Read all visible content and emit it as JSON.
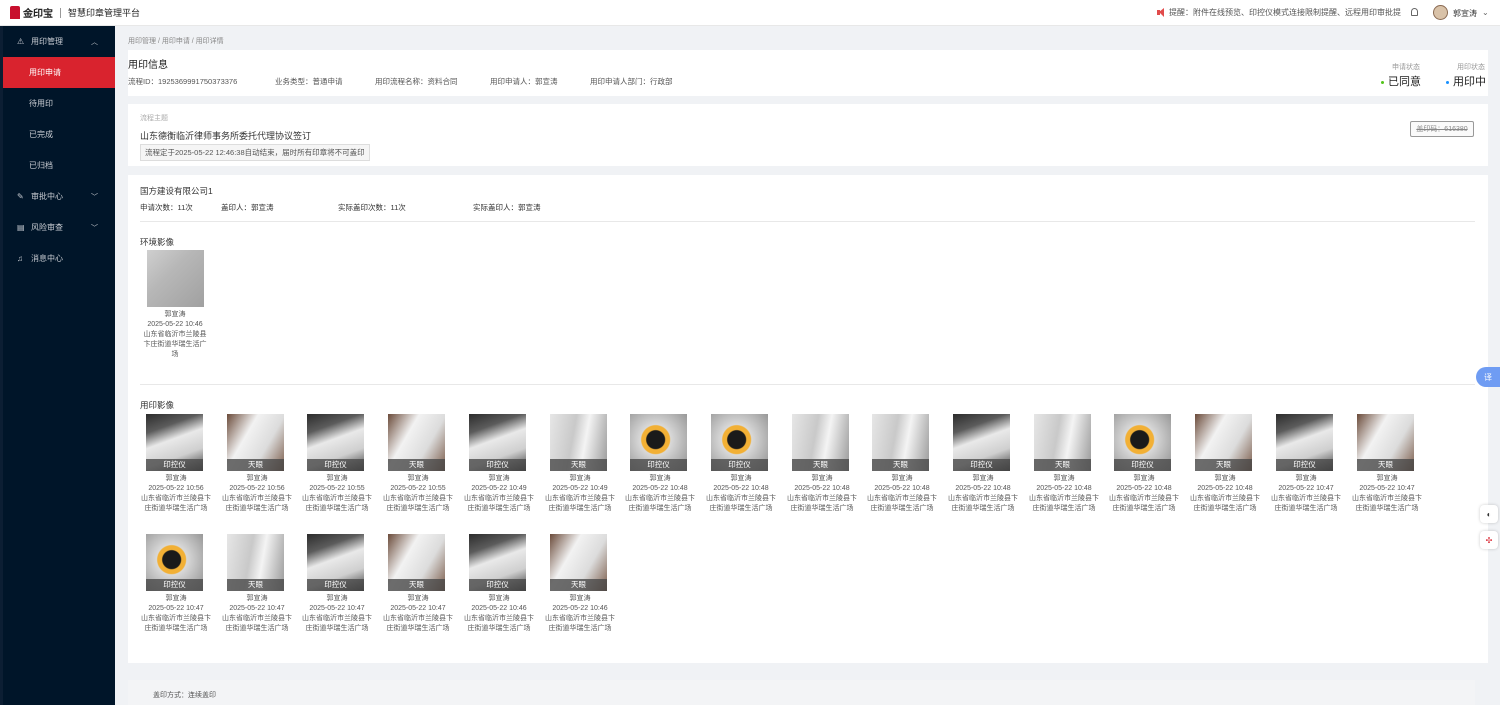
{
  "topbar": {
    "logo_text": "金印宝",
    "system_title": "智慧印章管理平台",
    "notice": "提醒：附件在线预览、印控仪模式连接限制提醒、远程用印审批提",
    "username": "郭宣涛"
  },
  "sidebar": {
    "items": [
      {
        "label": "用印管理",
        "icon": "⚠",
        "arrow": "︿",
        "type": "group"
      },
      {
        "label": "用印申请",
        "type": "sub",
        "active": true
      },
      {
        "label": "待用印",
        "type": "sub"
      },
      {
        "label": "已完成",
        "type": "sub"
      },
      {
        "label": "已归档",
        "type": "sub"
      },
      {
        "label": "审批中心",
        "icon": "✎",
        "arrow": "﹀",
        "type": "group"
      },
      {
        "label": "风险审查",
        "icon": "▤",
        "arrow": "﹀",
        "type": "group"
      },
      {
        "label": "消息中心",
        "icon": "♫",
        "type": "group"
      }
    ]
  },
  "breadcrumb": "用印管理 / 用印申请 / 用印详情",
  "header": {
    "title": "用印信息",
    "process_id": "流程ID：1925369991750373376",
    "business_type": "业务类型：普通申请",
    "process_name": "用印流程名称：资料合同",
    "applicant": "用印申请人：郭宣涛",
    "department": "用印申请人部门：行政部",
    "apply_status_label": "申请状态",
    "apply_status_value": "已同意",
    "apply_status_color": "#52c41a",
    "seal_status_label": "用印状态",
    "seal_status_value": "用印中",
    "seal_status_color": "#1890ff"
  },
  "flow": {
    "label": "流程主题",
    "title": "山东德衡临沂律师事务所委托代理协议签订",
    "tag": "流程定于2025-05-22 12:46:38自动结束，届时所有印章将不可盖印",
    "seal_no": "盖印码：616380"
  },
  "company": {
    "name": "国方建设有限公司1",
    "apply_count": "申请次数：11次",
    "sealer": "盖印人：郭宣涛",
    "actual_count": "实际盖印次数：11次",
    "actual_sealer": "实际盖印人：郭宣涛"
  },
  "env": {
    "label": "环境影像",
    "person": "郭宣涛",
    "time": "2025-05-22 10:46",
    "location": "山东省临沂市兰陵县卞庄街道华瑞生活广场"
  },
  "seal_images": {
    "label": "用印影像",
    "items": [
      {
        "badge": "印控仪",
        "person": "郭宣涛",
        "time": "2025-05-22 10:56",
        "location": "山东省临沂市兰陵县卞庄街道华瑞生活广场",
        "style": "a"
      },
      {
        "badge": "天眼",
        "person": "郭宣涛",
        "time": "2025-05-22 10:56",
        "location": "山东省临沂市兰陵县卞庄街道华瑞生活广场",
        "style": "b"
      },
      {
        "badge": "印控仪",
        "person": "郭宣涛",
        "time": "2025-05-22 10:55",
        "location": "山东省临沂市兰陵县卞庄街道华瑞生活广场",
        "style": "a"
      },
      {
        "badge": "天眼",
        "person": "郭宣涛",
        "time": "2025-05-22 10:55",
        "location": "山东省临沂市兰陵县卞庄街道华瑞生活广场",
        "style": "b"
      },
      {
        "badge": "印控仪",
        "person": "郭宣涛",
        "time": "2025-05-22 10:49",
        "location": "山东省临沂市兰陵县卞庄街道华瑞生活广场",
        "style": "a"
      },
      {
        "badge": "天眼",
        "person": "郭宣涛",
        "time": "2025-05-22 10:49",
        "location": "山东省临沂市兰陵县卞庄街道华瑞生活广场",
        "style": "c"
      },
      {
        "badge": "印控仪",
        "person": "郭宣涛",
        "time": "2025-05-22 10:48",
        "location": "山东省临沂市兰陵县卞庄街道华瑞生活广场",
        "style": "d"
      },
      {
        "badge": "印控仪",
        "person": "郭宣涛",
        "time": "2025-05-22 10:48",
        "location": "山东省临沂市兰陵县卞庄街道华瑞生活广场",
        "style": "d"
      },
      {
        "badge": "天眼",
        "person": "郭宣涛",
        "time": "2025-05-22 10:48",
        "location": "山东省临沂市兰陵县卞庄街道华瑞生活广场",
        "style": "c"
      },
      {
        "badge": "天眼",
        "person": "郭宣涛",
        "time": "2025-05-22 10:48",
        "location": "山东省临沂市兰陵县卞庄街道华瑞生活广场",
        "style": "c"
      },
      {
        "badge": "印控仪",
        "person": "郭宣涛",
        "time": "2025-05-22 10:48",
        "location": "山东省临沂市兰陵县卞庄街道华瑞生活广场",
        "style": "a"
      },
      {
        "badge": "天眼",
        "person": "郭宣涛",
        "time": "2025-05-22 10:48",
        "location": "山东省临沂市兰陵县卞庄街道华瑞生活广场",
        "style": "c"
      },
      {
        "badge": "印控仪",
        "person": "郭宣涛",
        "time": "2025-05-22 10:48",
        "location": "山东省临沂市兰陵县卞庄街道华瑞生活广场",
        "style": "d"
      },
      {
        "badge": "天眼",
        "person": "郭宣涛",
        "time": "2025-05-22 10:48",
        "location": "山东省临沂市兰陵县卞庄街道华瑞生活广场",
        "style": "b"
      },
      {
        "badge": "印控仪",
        "person": "郭宣涛",
        "time": "2025-05-22 10:47",
        "location": "山东省临沂市兰陵县卞庄街道华瑞生活广场",
        "style": "a"
      },
      {
        "badge": "天眼",
        "person": "郭宣涛",
        "time": "2025-05-22 10:47",
        "location": "山东省临沂市兰陵县卞庄街道华瑞生活广场",
        "style": "b"
      },
      {
        "badge": "印控仪",
        "person": "郭宣涛",
        "time": "2025-05-22 10:47",
        "location": "山东省临沂市兰陵县卞庄街道华瑞生活广场",
        "style": "d"
      },
      {
        "badge": "天眼",
        "person": "郭宣涛",
        "time": "2025-05-22 10:47",
        "location": "山东省临沂市兰陵县卞庄街道华瑞生活广场",
        "style": "c"
      },
      {
        "badge": "印控仪",
        "person": "郭宣涛",
        "time": "2025-05-22 10:47",
        "location": "山东省临沂市兰陵县卞庄街道华瑞生活广场",
        "style": "a"
      },
      {
        "badge": "天眼",
        "person": "郭宣涛",
        "time": "2025-05-22 10:47",
        "location": "山东省临沂市兰陵县卞庄街道华瑞生活广场",
        "style": "b"
      },
      {
        "badge": "印控仪",
        "person": "郭宣涛",
        "time": "2025-05-22 10:46",
        "location": "山东省临沂市兰陵县卞庄街道华瑞生活广场",
        "style": "a"
      },
      {
        "badge": "天眼",
        "person": "郭宣涛",
        "time": "2025-05-22 10:46",
        "location": "山东省临沂市兰陵县卞庄街道华瑞生活广场",
        "style": "b"
      }
    ]
  },
  "footer": {
    "seal_mode": "盖印方式：连续盖印"
  },
  "float": {
    "tab_label": "译"
  }
}
